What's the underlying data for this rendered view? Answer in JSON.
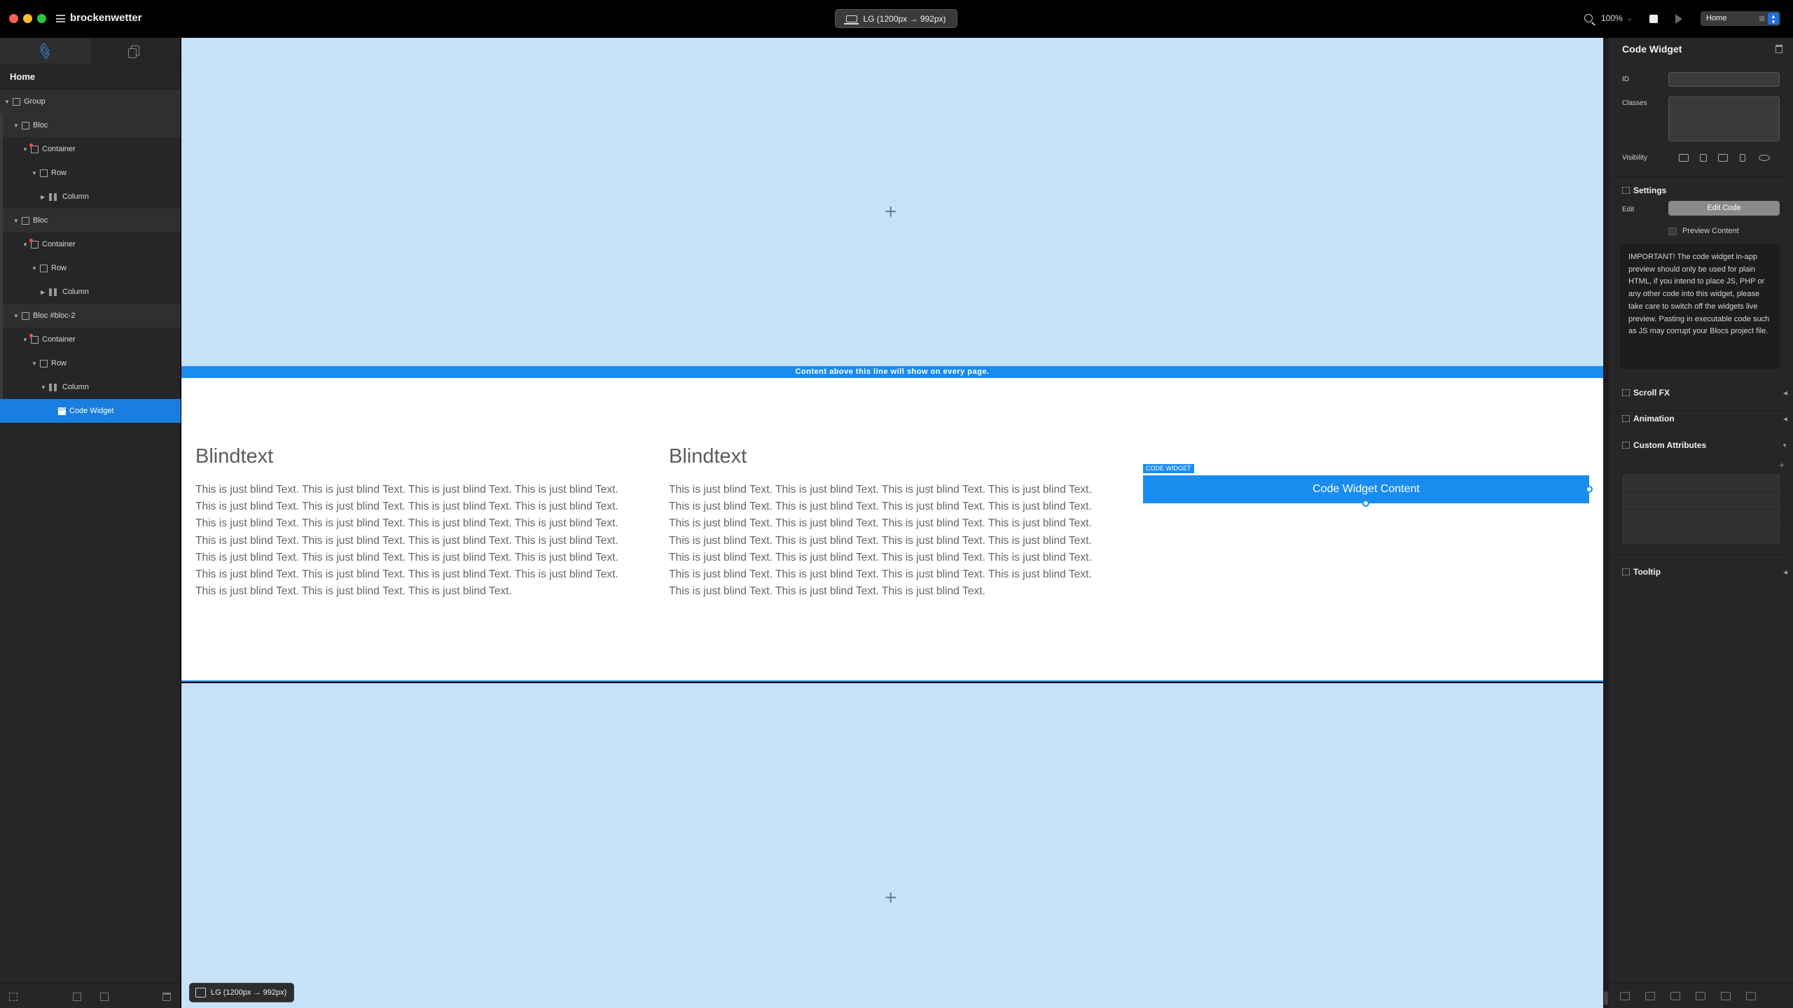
{
  "app": {
    "project_name": "brockenwetter",
    "breakpoint": "LG (1200px → 992px)",
    "zoom": "100%",
    "page_select": "Home"
  },
  "left_panel": {
    "home_label": "Home",
    "tree": [
      {
        "label": "Group",
        "depth": 0,
        "icon": "group-icon",
        "type": "group"
      },
      {
        "label": "Bloc",
        "depth": 1,
        "icon": "bloc-icon",
        "type": "bloc"
      },
      {
        "label": "Container",
        "depth": 2,
        "icon": "container-icon",
        "type": "container"
      },
      {
        "label": "Row",
        "depth": 3,
        "icon": "row-icon",
        "type": "row"
      },
      {
        "label": "Column",
        "depth": 4,
        "icon": "column-icon",
        "type": "column"
      },
      {
        "label": "Bloc",
        "depth": 1,
        "icon": "bloc-icon",
        "type": "bloc"
      },
      {
        "label": "Container",
        "depth": 2,
        "icon": "container-icon",
        "type": "container"
      },
      {
        "label": "Row",
        "depth": 3,
        "icon": "row-icon",
        "type": "row"
      },
      {
        "label": "Column",
        "depth": 4,
        "icon": "column-icon",
        "type": "column"
      },
      {
        "label": "Bloc #bloc-2",
        "depth": 1,
        "icon": "bloc-icon",
        "type": "bloc"
      },
      {
        "label": "Container",
        "depth": 2,
        "icon": "container-icon",
        "type": "container"
      },
      {
        "label": "Row",
        "depth": 3,
        "icon": "row-icon",
        "type": "row"
      },
      {
        "label": "Column",
        "depth": 4,
        "icon": "column-icon",
        "type": "column"
      },
      {
        "label": "Code Widget",
        "depth": 5,
        "icon": "code-widget-icon",
        "type": "code",
        "selected": true
      }
    ]
  },
  "canvas": {
    "global_line": "Content above this line will show on every page.",
    "columns": [
      {
        "heading": "Blindtext",
        "text": "This is just blind Text. This is just blind Text. This is just blind Text. This is just blind Text. This is just blind Text. This is just blind Text. This is just blind Text. This is just blind Text. This is just blind Text. This is just blind Text. This is just blind Text. This is just blind Text. This is just blind Text. This is just blind Text. This is just blind Text. This is just blind Text. This is just blind Text. This is just blind Text. This is just blind Text. This is just blind Text. This is just blind Text. This is just blind Text. This is just blind Text. This is just blind Text. This is just blind Text. This is just blind Text. This is just blind Text."
      },
      {
        "heading": "Blindtext",
        "text": "This is just blind Text. This is just blind Text. This is just blind Text. This is just blind Text. This is just blind Text. This is just blind Text. This is just blind Text. This is just blind Text. This is just blind Text. This is just blind Text. This is just blind Text. This is just blind Text. This is just blind Text. This is just blind Text. This is just blind Text. This is just blind Text. This is just blind Text. This is just blind Text. This is just blind Text. This is just blind Text. This is just blind Text. This is just blind Text. This is just blind Text. This is just blind Text. This is just blind Text. This is just blind Text. This is just blind Text."
      }
    ],
    "code_widget_tag": "CODE WIDGET",
    "code_widget_content": "Code Widget Content",
    "add_symbol": "+",
    "badge": "LG (1200px → 992px)"
  },
  "inspector": {
    "title": "Code Widget",
    "id_label": "ID",
    "id_value": "",
    "classes_label": "Classes",
    "visibility_label": "Visibility",
    "settings_title": "Settings",
    "edit_label": "Edit",
    "edit_code_button": "Edit Code",
    "preview_label": "Preview Content",
    "important_note": "IMPORTANT! The code widget in-app preview should only be used for plain HTML, if you intend to place JS, PHP or any other code into this widget, please take care to switch off the widgets live preview. Pasting in executable code such as JS may corrupt your Blocs project file.",
    "sections": {
      "scroll_fx": "Scroll FX",
      "animation": "Animation",
      "custom_attributes": "Custom Attributes",
      "tooltip": "Tooltip"
    },
    "add_symbol": "+"
  },
  "colors": {
    "accent": "#1a8cf0",
    "bloc_bg": "#c5e2f9",
    "panel_bg": "#262628"
  }
}
